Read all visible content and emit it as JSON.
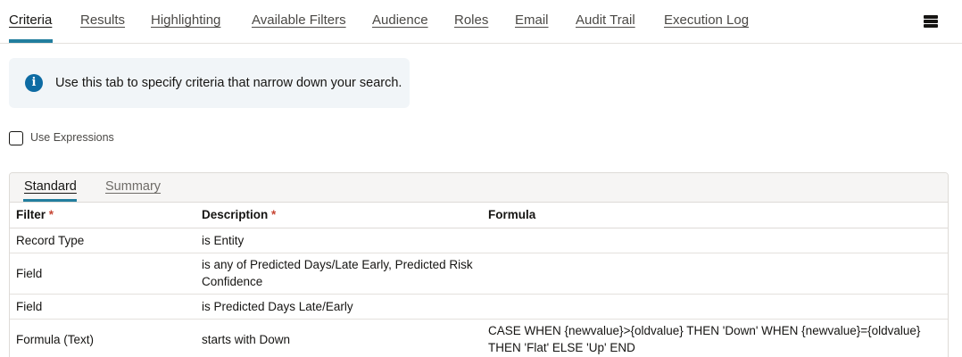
{
  "tabs": [
    {
      "label": "Criteria",
      "active": true
    },
    {
      "label": "Results"
    },
    {
      "label": "Highlighting"
    },
    {
      "label": "Available Filters"
    },
    {
      "label": "Audience"
    },
    {
      "label": "Roles"
    },
    {
      "label": "Email"
    },
    {
      "label": "Audit Trail"
    },
    {
      "label": "Execution Log"
    }
  ],
  "menu_icon": "hamburger-menu-icon",
  "info": {
    "icon": "info-icon",
    "icon_glyph": "i",
    "text": "Use this tab to specify criteria that narrow down your search.",
    "accent": "#0d6ba3"
  },
  "use_expressions": {
    "label": "Use Expressions",
    "checked": false
  },
  "subtabs": [
    {
      "label": "Standard",
      "active": true
    },
    {
      "label": "Summary"
    }
  ],
  "table": {
    "headers": {
      "filter": "Filter",
      "description": "Description",
      "formula": "Formula",
      "required_mark": "*"
    },
    "rows": [
      {
        "filter": "Record Type",
        "description": "is Entity",
        "formula": ""
      },
      {
        "filter": "Field",
        "description": "is any of Predicted Days/Late Early, Predicted Risk Confidence",
        "formula": ""
      },
      {
        "filter": "Field",
        "description": "is Predicted Days Late/Early",
        "formula": ""
      },
      {
        "filter": "Formula (Text)",
        "description": "starts with Down",
        "formula": "CASE WHEN {newvalue}>{oldvalue} THEN 'Down' WHEN {newvalue}={oldvalue} THEN 'Flat' ELSE 'Up' END"
      }
    ]
  },
  "colors": {
    "accent": "#227e9e",
    "required": "#c74634"
  }
}
